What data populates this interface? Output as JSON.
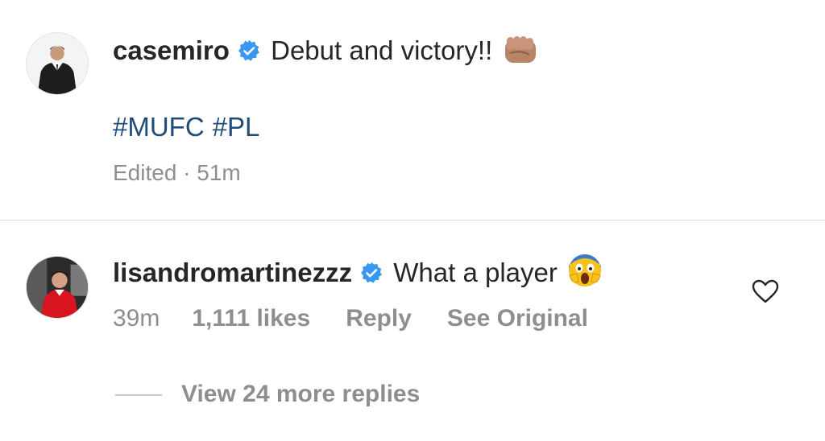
{
  "post": {
    "username": "casemiro",
    "verified": true,
    "caption": "Debut and victory!!",
    "caption_emoji": "oncoming-fist-medium-skin-tone",
    "hashtags": [
      "#MUFC",
      "#PL"
    ],
    "meta": "Edited · 51m"
  },
  "reply": {
    "username": "lisandromartinezzz",
    "verified": true,
    "text": "What a player",
    "text_emoji": "face-screaming-in-fear",
    "time": "39m",
    "likes": "1,111 likes",
    "reply_label": "Reply",
    "see_original_label": "See Original"
  },
  "view_more": {
    "label": "View 24 more replies"
  },
  "colors": {
    "text": "#262626",
    "secondary": "#8e8e8e",
    "hashtag": "#1f4b7a",
    "verified": "#3897f0",
    "divider": "#dbdbdb"
  },
  "icons": {
    "verified": "verified-badge-icon",
    "like": "heart-outline-icon"
  }
}
